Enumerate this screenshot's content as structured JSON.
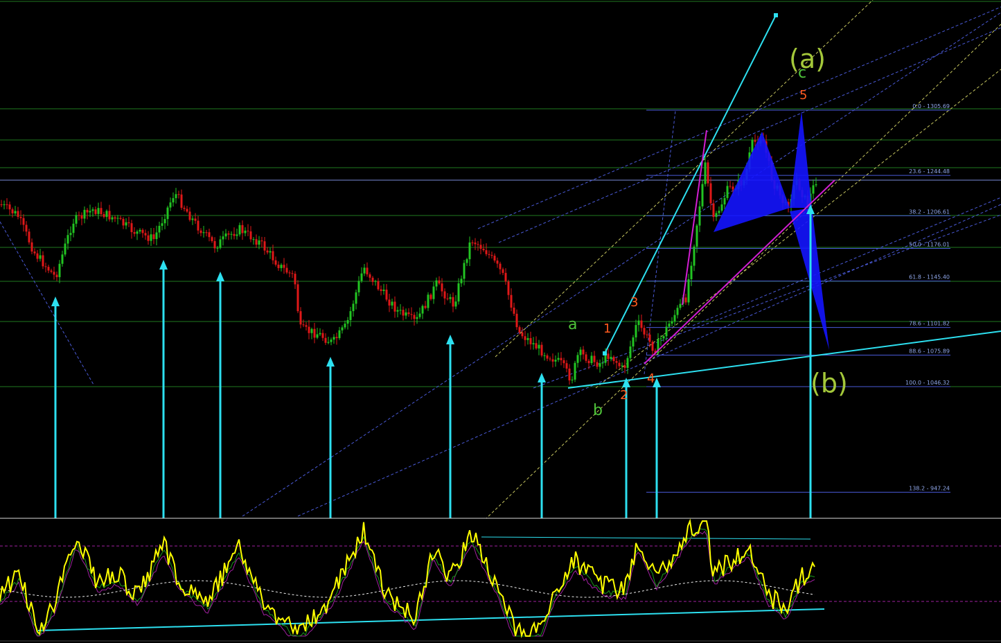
{
  "chart_data": {
    "type": "candlestick",
    "fib_levels": [
      {
        "label": "0.0 - 1305.69",
        "value": 1305.69
      },
      {
        "label": "23.6 - 1244.48",
        "value": 1244.48
      },
      {
        "label": "38.2 - 1206.61",
        "value": 1206.61
      },
      {
        "label": "50.0 - 1176.01",
        "value": 1176.01
      },
      {
        "label": "61.8 - 1145.40",
        "value": 1145.4
      },
      {
        "label": "78.6 - 1101.82",
        "value": 1101.82
      },
      {
        "label": "88.6 - 1075.89",
        "value": 1075.89
      },
      {
        "label": "100.0 - 1046.32",
        "value": 1046.32
      },
      {
        "label": "138.2 - 947.24",
        "value": 947.24
      }
    ],
    "wave_labels": {
      "a": "a",
      "b": "b",
      "c": "c",
      "w1": "1",
      "w2": "2",
      "w3": "3",
      "w4": "4",
      "w5": "5",
      "big_a": "(a)",
      "big_b": "(b)"
    },
    "colors": {
      "bull": "#22c422",
      "bear": "#e01818",
      "fib": "#4a5ad8",
      "grid": "#1f7a1f",
      "arrows": "#2de0f0",
      "pattern": "#1414ff",
      "magenta": "#d21ed2",
      "oscillator": "#ffff00"
    }
  }
}
